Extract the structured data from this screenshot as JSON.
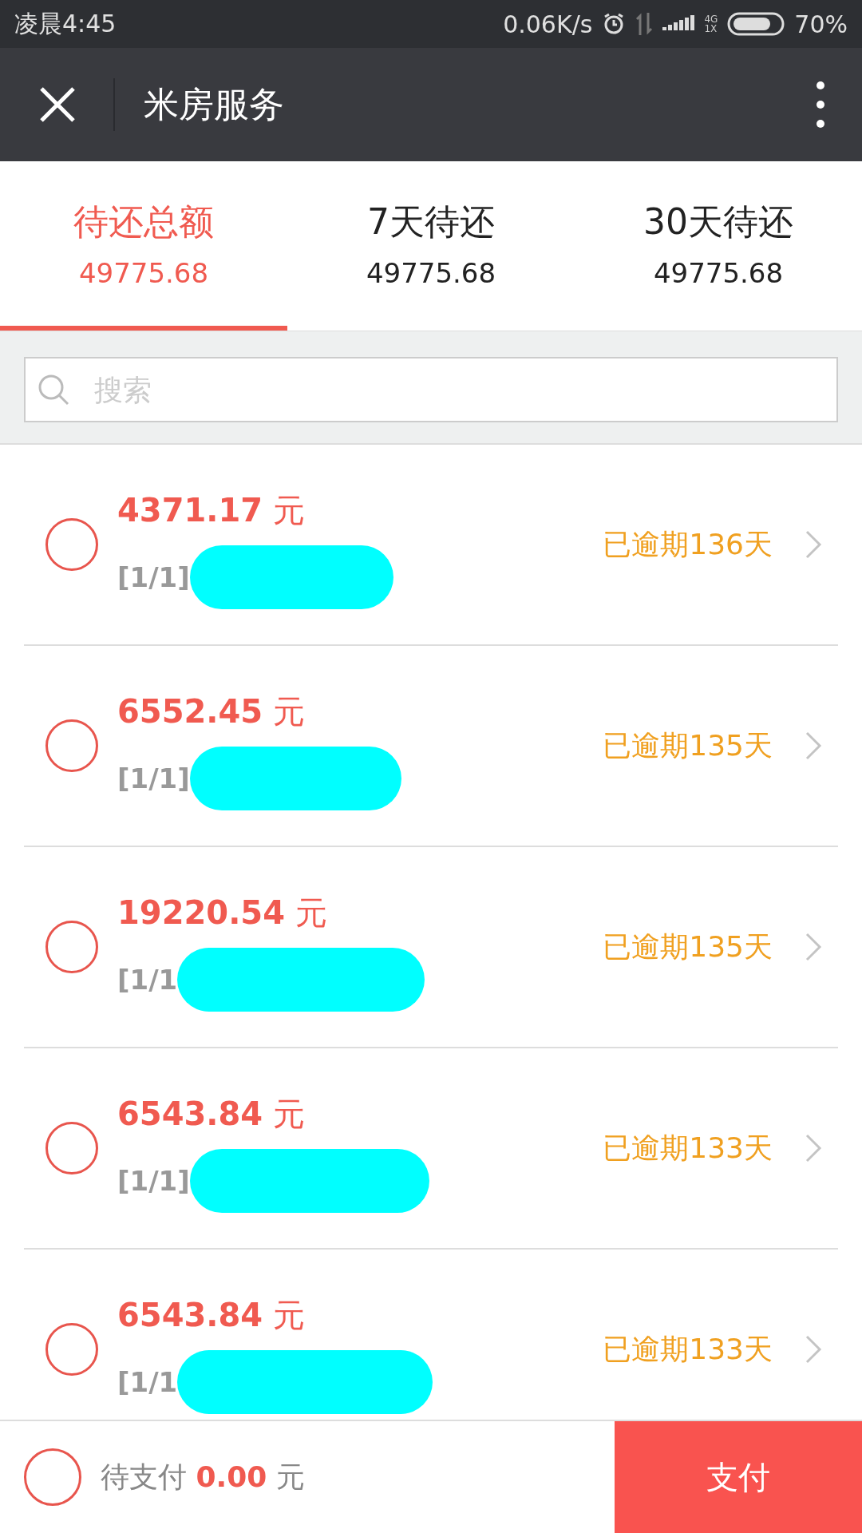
{
  "status_bar": {
    "time": "凌晨4:45",
    "speed": "0.06K/s",
    "network": "4G",
    "network2": "1X",
    "battery": "70%"
  },
  "header": {
    "title": "米房服务"
  },
  "tabs": [
    {
      "label": "待还总额",
      "amount": "49775.68",
      "selected": true
    },
    {
      "label": "7天待还",
      "amount": "49775.68",
      "selected": false
    },
    {
      "label": "30天待还",
      "amount": "49775.68",
      "selected": false
    }
  ],
  "search": {
    "placeholder": "搜索"
  },
  "bills": [
    {
      "amount": "**4371.17** 元",
      "caption": "[1/1]",
      "status": "已逾期136天",
      "checked": false
    },
    {
      "amount": "**6552.45** 元",
      "caption": "[1/1]",
      "status": "已逾期135天",
      "checked": false
    },
    {
      "amount": "**19220.54** 元",
      "caption": "[1/1",
      "status": "已逾期135天",
      "checked": false
    },
    {
      "amount": "**6543.84** 元",
      "caption": "[1/1]",
      "status": "已逾期133天",
      "checked": false
    },
    {
      "amount": "**6543.84** 元",
      "caption": "[1/1",
      "status": "已逾期133天",
      "checked": false
    }
  ],
  "footer": {
    "checked": false,
    "total": "待支付 **0.00** 元",
    "pay_button": "支付"
  }
}
